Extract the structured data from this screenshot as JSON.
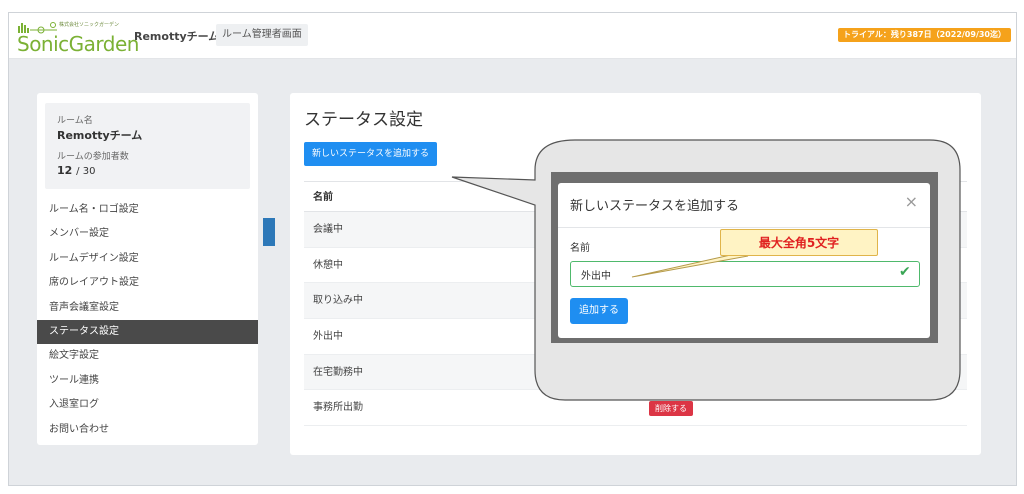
{
  "header": {
    "logo_text": "SonicGarden",
    "logo_subtext": "株式会社ソニックガーデン",
    "team_name": "Remottyチーム",
    "admin_chip": "ルーム管理者画面",
    "trial_badge": "トライアル：残り387日（2022/09/30迄）"
  },
  "sidebar": {
    "room_name_label": "ルーム名",
    "room_name": "Remottyチーム",
    "members_label": "ルームの参加者数",
    "members_current": "12",
    "members_total": "/ 30",
    "items": [
      {
        "label": "ルーム名・ロゴ設定"
      },
      {
        "label": "メンバー設定"
      },
      {
        "label": "ルームデザイン設定"
      },
      {
        "label": "席のレイアウト設定"
      },
      {
        "label": "音声会議室設定"
      },
      {
        "label": "ステータス設定",
        "active": true
      },
      {
        "label": "絵文字設定"
      },
      {
        "label": "ツール連携"
      },
      {
        "label": "入退室ログ"
      },
      {
        "label": "お問い合わせ"
      }
    ]
  },
  "main": {
    "title": "ステータス設定",
    "add_button": "新しいステータスを追加する",
    "table_header": "名前",
    "rows": [
      "会議中",
      "休憩中",
      "取り込み中",
      "外出中",
      "在宅勤務中",
      "事務所出勤"
    ],
    "delete_label": "削除する"
  },
  "modal": {
    "title": "新しいステータスを追加する",
    "close": "×",
    "field_label": "名前",
    "field_value": "外出中",
    "submit": "追加する"
  },
  "annotation": {
    "note": "最大全角5文字"
  },
  "colors": {
    "brand_green": "#7bb135",
    "primary": "#1f8ef1",
    "danger": "#dc3545",
    "trial": "#f5a21b",
    "active_menu": "#4a4a4a"
  }
}
